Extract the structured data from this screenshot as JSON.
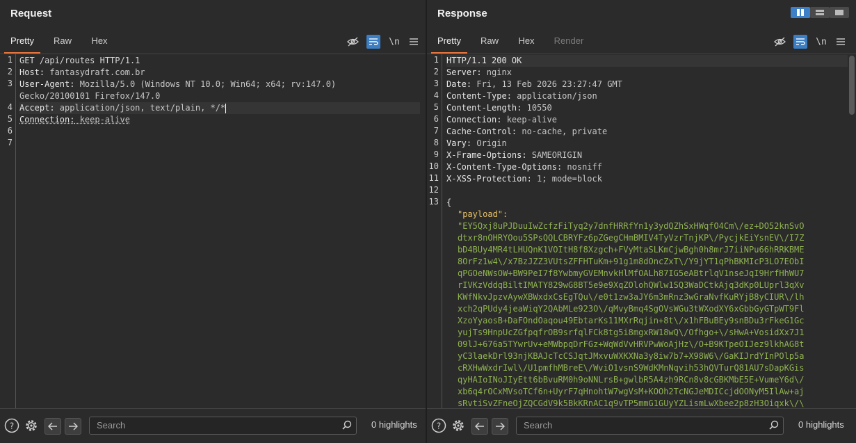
{
  "request": {
    "title": "Request",
    "tabs": [
      "Pretty",
      "Raw",
      "Hex"
    ],
    "newline_label": "\\n",
    "line_numbers": [
      "1",
      "2",
      "3",
      "",
      "4",
      "5",
      "6",
      "7"
    ],
    "lines": {
      "l1": "GET /api/routes HTTP/1.1",
      "l2k": "Host:",
      "l2v": " fantasydraft.com.br",
      "l3k": "User-Agent:",
      "l3v": " Mozilla/5.0 (Windows NT 10.0; Win64; x64; rv:147.0)",
      "l3b": "Gecko/20100101 Firefox/147.0",
      "l4k": "Accept:",
      "l4v": " application/json, text/plain, */*",
      "l5k": "Connection:",
      "l5v": " keep-alive"
    },
    "search_placeholder": "Search",
    "highlights": "0 highlights"
  },
  "response": {
    "title": "Response",
    "tabs": [
      "Pretty",
      "Raw",
      "Hex",
      "Render"
    ],
    "newline_label": "\\n",
    "line_numbers": [
      "1",
      "2",
      "3",
      "4",
      "5",
      "6",
      "7",
      "8",
      "9",
      "10",
      "11",
      "12",
      "13"
    ],
    "headers": [
      {
        "k": "HTTP/1.1 200 OK",
        "v": ""
      },
      {
        "k": "Server:",
        "v": " nginx"
      },
      {
        "k": "Date:",
        "v": " Fri, 13 Feb 2026 23:27:47 GMT"
      },
      {
        "k": "Content-Type:",
        "v": " application/json"
      },
      {
        "k": "Content-Length:",
        "v": " 10550"
      },
      {
        "k": "Connection:",
        "v": " keep-alive"
      },
      {
        "k": "Cache-Control:",
        "v": " no-cache, private"
      },
      {
        "k": "Vary:",
        "v": " Origin"
      },
      {
        "k": "X-Frame-Options:",
        "v": " SAMEORIGIN"
      },
      {
        "k": "X-Content-Type-Options:",
        "v": " nosniff"
      },
      {
        "k": "X-XSS-Protection:",
        "v": " 1; mode=block"
      }
    ],
    "brace": "{",
    "payload_key": "\"payload\":",
    "payload_lines": [
      "\"EY5Qxj8uPJDuuIwZcfzFiTyq2y7dnfHRRfYn1y3ydQZhSxHWqfO4Cm\\/ez+DO52knSvO",
      "dtxr8nOHRYOou5SPsQQLCBRYFz6pZGegCHmBMIV4TyVzrTnjKP\\/PycjkEiYsnEV\\/I7Z",
      "bD4BUy4MR4tLHUQnK1VOItH8f8Xzgch+FVyMtaSLKmCjwBgh0h8mrJ7iiNPu66hRRKBME",
      "8OrFz1w4\\/x7BzJZZ3VUtsZFFHTuKm+91g1m8dOncZxT\\/Y9jYT1qPhBKMIcP3LO7EObI",
      "qPGOeNWsOW+BW9PeI7f8YwbmyGVEMnvkHlMfOALh87IG5eABtrlqV1nseJqI9HrfHhWU7",
      "rIVKzVddqBiltIMATY829wG8BT5e9e9XqZOlohQWlw1SQ3WaDCtkAjq3dKp0LUprl3qXv",
      "KWfNkvJpzvAywXBWxdxCsEgTQu\\/e0t1zw3aJY6m3mRnz3wGraNvfKuRYjB8yCIUR\\/lh",
      "xch2qPUdy4jeaWiqY2QAbMLe923O\\/qMvyBmq4SgOVsWGu3tWXodXY6xGbbGyGTpWT9Fl",
      "XzoYyaosB+DaFOndOaqou49EbtarKs11MXrRqjin+8t\\/x1hFBuBEy9snBDu3rFkeG1Gc",
      "yujTs9HnpUcZGfpqfrOB9srfqlFCk8tg5i8mgxRW18wQ\\/Ofhgo+\\/sHwA+VosidXx7J1",
      "09lJ+676a5TYwrUv+eMWbpqDrFGz+WqWdVvHRVPwWoAjHz\\/O+B9KTpeOIJez9lkhAG8t",
      "yC3laekDrl93njKBAJcTcCSJqtJMxvuWXKXNa3y8iw7b7+X98W6\\/GaKIJrdYInPOlp5a",
      "cRXHwWxdrIwl\\/U1pmfhMBreE\\/WviO1vsnS9WdKMnNqvih53hQVTurQ81AU7sDapKGis",
      "qyHAIoINoJIyEtt6bBvuRM0h9oNNLrsB+gwlbR5A4zh9RCn8v8cGBKMbE5E+VumeY6d\\/",
      "xb6q4rOCxMVsoTCf6n+UyrF7qHnohtW7wgVsM+KOOh2TcNGJeMDICcjdOONyM5IlAw+aj",
      "sRvtiSvZFneOjZQCGdV9k5BkKRnAC1q9vTP5mmG1GUyYZLismLwXbee2p8zH3Oiqxk\\/\\"
    ],
    "search_placeholder": "Search",
    "highlights": "0 highlights"
  }
}
